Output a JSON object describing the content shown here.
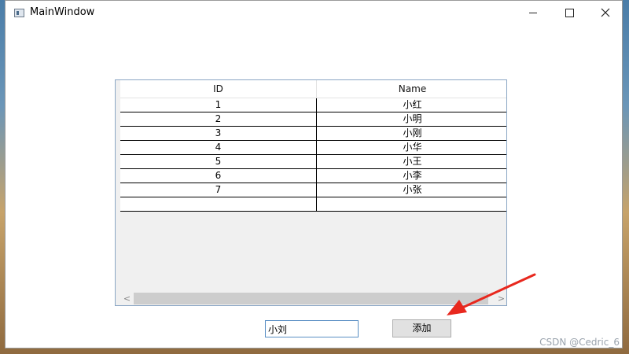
{
  "window": {
    "title": "MainWindow"
  },
  "grid": {
    "columns": [
      "ID",
      "Name"
    ],
    "rows": [
      {
        "id": "1",
        "name": "小红"
      },
      {
        "id": "2",
        "name": "小明"
      },
      {
        "id": "3",
        "name": "小刚"
      },
      {
        "id": "4",
        "name": "小华"
      },
      {
        "id": "5",
        "name": "小王"
      },
      {
        "id": "6",
        "name": "小李"
      },
      {
        "id": "7",
        "name": "小张"
      },
      {
        "id": "",
        "name": ""
      }
    ]
  },
  "form": {
    "name_value": "小刘",
    "add_label": "添加"
  },
  "watermark": "CSDN @Cedric_6",
  "colors": {
    "arrow": "#e8281e",
    "input_border": "#5a8fc4",
    "grid_border": "#8aa6c4"
  }
}
